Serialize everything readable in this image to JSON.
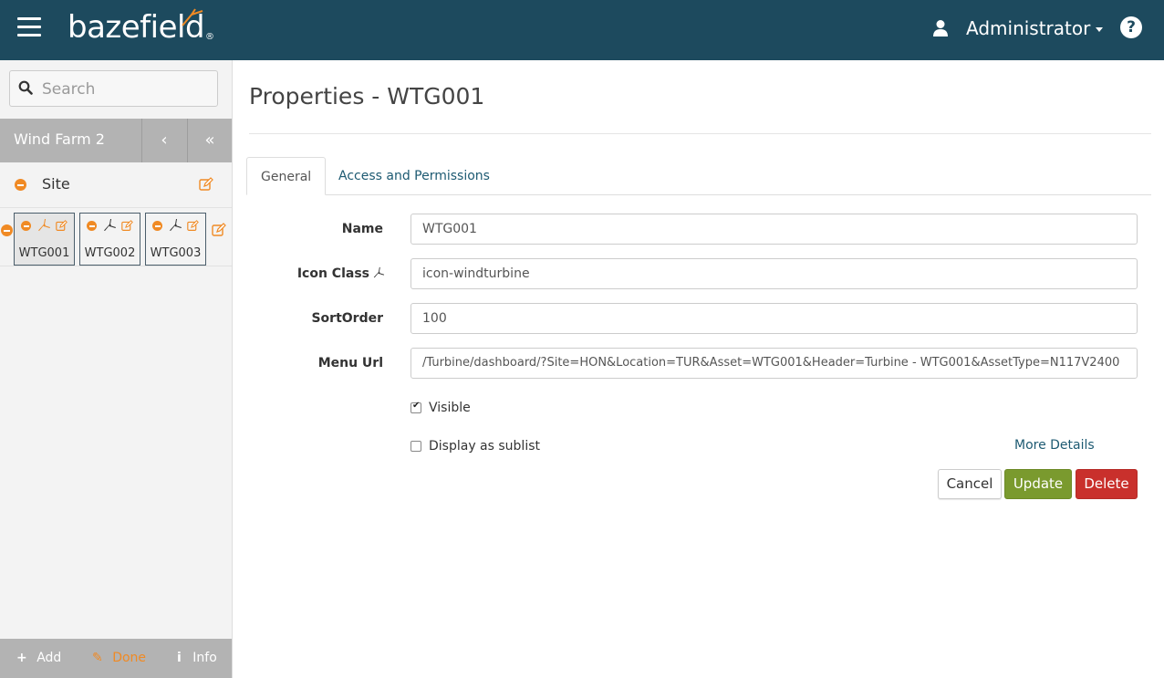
{
  "header": {
    "logo_text": "bazefield",
    "logo_reg": "®",
    "user_name": "Administrator",
    "help_label": "?",
    "icons": {
      "menu": "hamburger-icon",
      "user": "user-icon",
      "help": "question-circle-icon"
    },
    "colors": {
      "bar": "#1d4a5e"
    }
  },
  "sidebar": {
    "search_placeholder": "Search",
    "farm_title": "Wind Farm 2",
    "back_label": "‹",
    "collapse_label": "«",
    "site_label": "Site",
    "turbines": [
      {
        "name": "WTG001",
        "active": true
      },
      {
        "name": "WTG002",
        "active": false
      },
      {
        "name": "WTG003",
        "active": false
      }
    ],
    "footer": {
      "add": "Add",
      "done": "Done",
      "info": "Info"
    },
    "colors": {
      "accent": "#f08a24",
      "bar": "#b3b3b3"
    }
  },
  "main": {
    "title": "Properties - WTG001",
    "tabs": [
      {
        "label": "General",
        "active": true
      },
      {
        "label": "Access and Permissions",
        "active": false
      }
    ],
    "form": {
      "name_label": "Name",
      "name_value": "WTG001",
      "icon_class_label": "Icon Class",
      "icon_class_value": "icon-windturbine",
      "sort_order_label": "SortOrder",
      "sort_order_value": "100",
      "menu_url_label": "Menu Url",
      "menu_url_value": "/Turbine/dashboard/?Site=HON&Location=TUR&Asset=WTG001&Header=Turbine - WTG001&AssetType=N117V2400",
      "visible_label": "Visible",
      "visible_checked": true,
      "sublist_label": "Display as sublist",
      "sublist_checked": false,
      "more_details": "More Details"
    },
    "buttons": {
      "cancel": "Cancel",
      "update": "Update",
      "delete": "Delete"
    },
    "colors": {
      "update": "#7a9a2e",
      "delete": "#c9302c",
      "link": "#1d5a72"
    }
  }
}
